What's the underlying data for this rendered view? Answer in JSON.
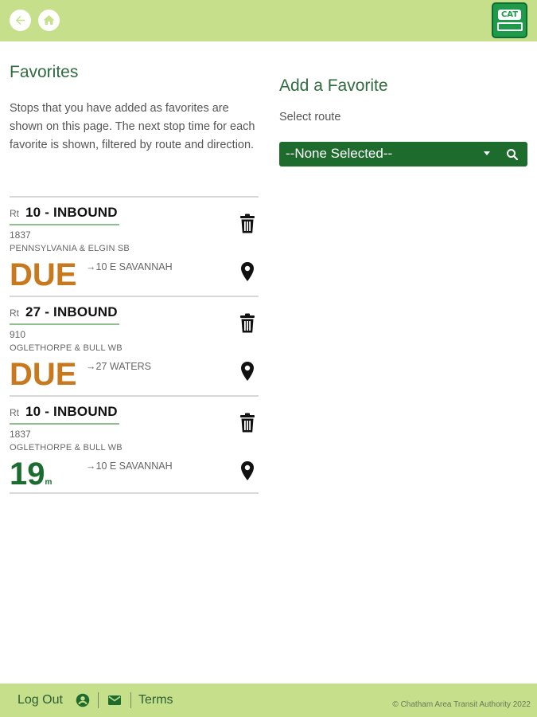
{
  "header": {
    "back_icon": "arrow-left-circle-icon",
    "home_icon": "home-icon",
    "logo_text": "CAT"
  },
  "favorites": {
    "title": "Favorites",
    "intro": "Stops that you have added as favorites are shown on this page. The next stop time for each favorite is shown, filtered by route and direction.",
    "items": [
      {
        "rt_label": "Rt",
        "route": "10 - INBOUND",
        "stop_number": "1837",
        "stop_name": "PENNSYLVANIA & ELGIN SB",
        "arrival": "DUE",
        "arrival_unit": "",
        "destination": "→10 E SAVANNAH"
      },
      {
        "rt_label": "Rt",
        "route": "27 - INBOUND",
        "stop_number": "910",
        "stop_name": "OGLETHORPE & BULL WB",
        "arrival": "DUE",
        "arrival_unit": "",
        "destination": "→27 WATERS"
      },
      {
        "rt_label": "Rt",
        "route": "10 - INBOUND",
        "stop_number": "1837",
        "stop_name": "OGLETHORPE & BULL WB",
        "arrival": "19",
        "arrival_unit": "m",
        "destination": "→10 E SAVANNAH"
      }
    ]
  },
  "add_favorite": {
    "title": "Add a Favorite",
    "select_label": "Select route",
    "select_value": "--None Selected--"
  },
  "footer": {
    "logout": "Log Out",
    "terms": "Terms",
    "copyright": "© Chatham Area Transit Authority 2022"
  },
  "colors": {
    "header_bg": "#c5df8a",
    "brand_green": "#1e6b2e",
    "due_orange": "#c8781d",
    "title_green": "#2e6b3f"
  }
}
